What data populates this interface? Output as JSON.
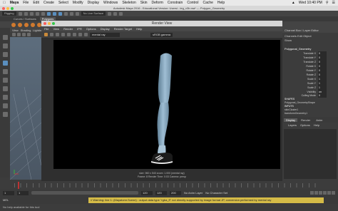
{
  "mac_menubar": {
    "app": "Maya",
    "items": [
      "File",
      "Edit",
      "Create",
      "Select",
      "Modify",
      "Display",
      "Windows",
      "Skeleton",
      "Skin",
      "Deform",
      "Constrain",
      "Control",
      "Cache",
      "Help"
    ],
    "clock": "Wed 10:40 PM"
  },
  "window_title": "Autodesk Maya 2016 - Educational Version: Users/...leg_v3b.ma* --- Polygon_Geometry",
  "status_line": {
    "mode": "Rigging",
    "live_surface": "No Live Surface"
  },
  "shelf": {
    "tabs": [
      "Curves / Surfaces",
      "Polygons"
    ],
    "active_tab": "Polygons"
  },
  "viewport": {
    "menus": [
      "View",
      "Shading",
      "Lighting"
    ]
  },
  "render_view": {
    "title": "Render View",
    "menus": [
      "File",
      "View",
      "Render",
      "IPR",
      "Options",
      "Display",
      "Render Target",
      "Help"
    ],
    "renderer": "mental ray",
    "color_mode": "sRGB gamma",
    "info_line1": "size: 960 x 540  zoom: 1.000          (mental ray)",
    "info_line2": "Frame: 8          Render Time: 0:03          Camera: persp"
  },
  "channel_box": {
    "header": "Channel Box / Layer Editor",
    "menu_row1": [
      "Channels",
      "Edit",
      "Object"
    ],
    "menu_row2": [
      "Show"
    ],
    "object_name": "Polygonal_Geometry",
    "attributes": [
      {
        "name": "Translate X",
        "value": "0"
      },
      {
        "name": "Translate Y",
        "value": "0"
      },
      {
        "name": "Translate Z",
        "value": "0"
      },
      {
        "name": "Rotate X",
        "value": "0"
      },
      {
        "name": "Rotate Y",
        "value": "0"
      },
      {
        "name": "Rotate Z",
        "value": "0"
      },
      {
        "name": "Scale X",
        "value": "1"
      },
      {
        "name": "Scale Y",
        "value": "1"
      },
      {
        "name": "Scale Z",
        "value": "1"
      },
      {
        "name": "Visibility",
        "value": "on"
      },
      {
        "name": "Culling Mode",
        "value": "0"
      }
    ],
    "shapes_header": "SHAPES",
    "shape_name": "Polygonal_GeometryShape",
    "inputs_header": "INPUTS",
    "inputs": [
      "skinCluster1",
      "transformGeometry1"
    ]
  },
  "layer_editor": {
    "tabs": [
      "Display",
      "Render",
      "Anim"
    ],
    "active_tab": "Display",
    "menus": [
      "Layers",
      "Options",
      "Help"
    ]
  },
  "time_controls": {
    "start": "1",
    "current": "1",
    "range_start": "1",
    "range_end": "120",
    "end": "120",
    "end2": "200",
    "anim_layer": "No Anim Layer",
    "character_set": "No Character Set"
  },
  "command_line": {
    "lang": "MEL",
    "warning": "// Warning: line 1: (Mayatomr.Scene) : output data type \"rgba_fl\" not directly supported by image format JP, conversion performed by mental ray"
  },
  "help_line": "No help available for this tool",
  "colors": {
    "render_bg": "#000000",
    "leg_skin": "#8fb0c8",
    "warning": "#d5bb47",
    "accent_blue": "#5a8fbf"
  }
}
